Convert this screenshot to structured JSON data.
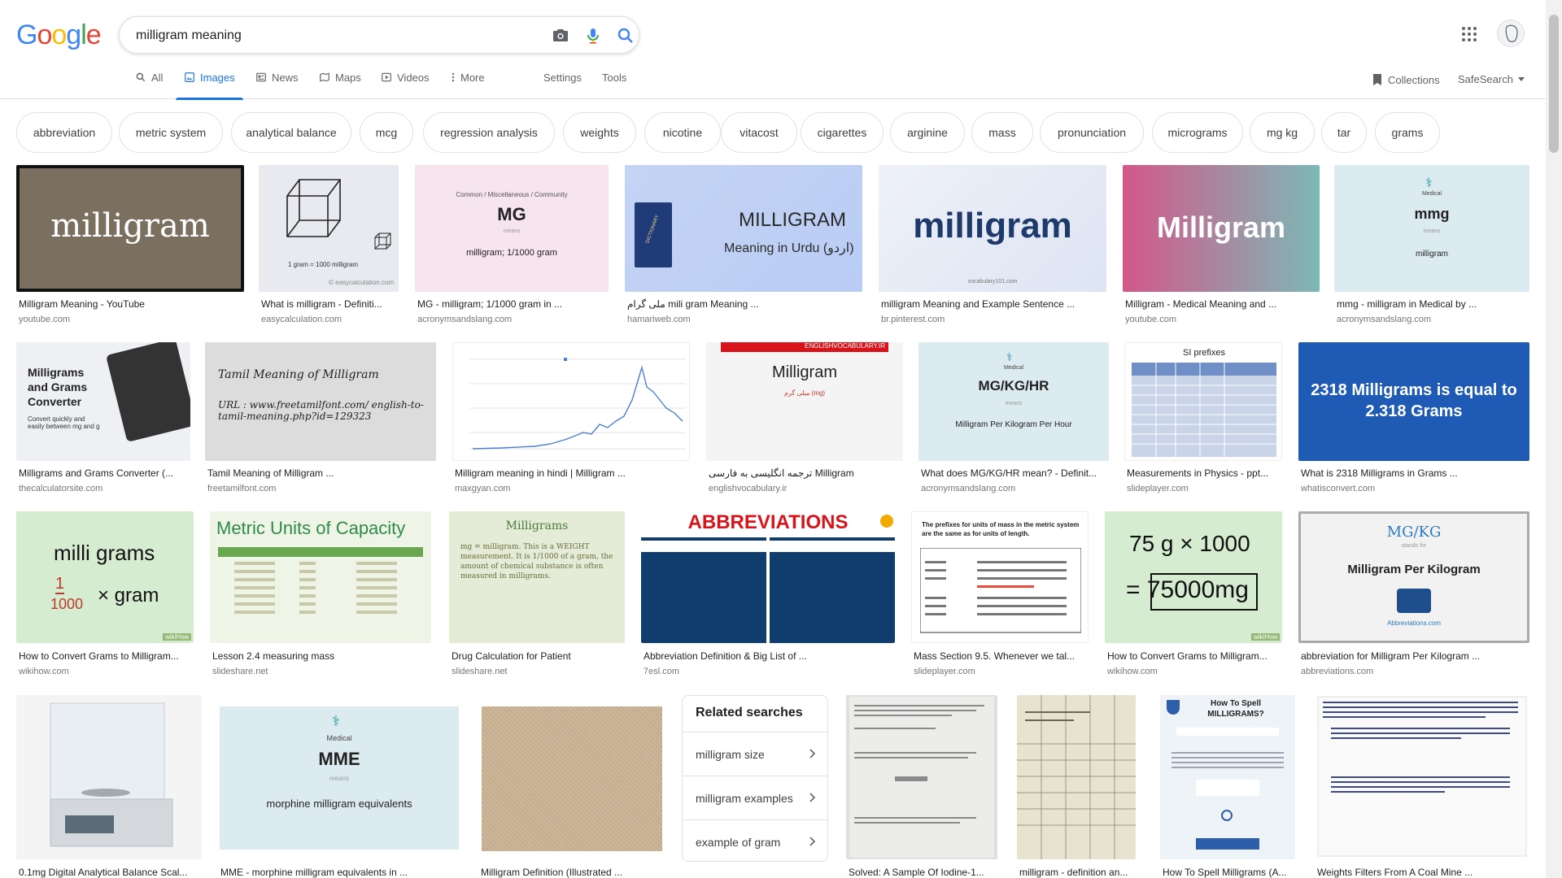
{
  "search": {
    "query": "milligram meaning"
  },
  "tabs": [
    {
      "label": "All",
      "icon": "search-icon"
    },
    {
      "label": "Images",
      "icon": "image-icon",
      "active": true
    },
    {
      "label": "News",
      "icon": "news-icon"
    },
    {
      "label": "Maps",
      "icon": "map-icon"
    },
    {
      "label": "Videos",
      "icon": "video-icon"
    },
    {
      "label": "More",
      "icon": "more-vert-icon"
    }
  ],
  "settings_label": "Settings",
  "tools_label": "Tools",
  "collections_label": "Collections",
  "safesearch_label": "SafeSearch",
  "chips": [
    "abbreviation",
    "metric system",
    "analytical balance",
    "mcg",
    "regression analysis",
    "weights",
    "nicotine",
    "vitacost",
    "cigarettes",
    "arginine",
    "mass",
    "pronunciation",
    "micrograms",
    "mg kg",
    "tar",
    "grams"
  ],
  "results": [
    {
      "caption": "Milligram Meaning - YouTube",
      "source": "youtube.com",
      "thumb_text": "milligram",
      "thumb_sub": ""
    },
    {
      "caption": "What is milligram - Definiti...",
      "source": "easycalculation.com",
      "thumb_text": "1 gram      =      1000 milligram",
      "thumb_sub": "© easycalculation.com"
    },
    {
      "caption": "MG - milligram; 1/1000 gram in ...",
      "source": "acronymsandslang.com",
      "thumb_text": "MG",
      "thumb_sub": "milligram; 1/1000 gram",
      "thumb_top": "Common / Miscellaneous / Community",
      "thumb_means": "means"
    },
    {
      "caption": "ملی گرام mili gram Meaning ...",
      "source": "hamariweb.com",
      "thumb_text": "MILLIGRAM",
      "thumb_sub": "Meaning in Urdu (اردو)",
      "thumb_book": "DICTIONARY"
    },
    {
      "caption": "milligram Meaning and Example Sentence ...",
      "source": "br.pinterest.com",
      "thumb_text": "milligram",
      "thumb_sub": "vocabulary101.com"
    },
    {
      "caption": "Milligram - Medical Meaning and ...",
      "source": "youtube.com",
      "thumb_text": "Milligram",
      "thumb_sub": ""
    },
    {
      "caption": "mmg - milligram in Medical by ...",
      "source": "acronymsandslang.com",
      "thumb_text": "mmg",
      "thumb_sub": "milligram",
      "thumb_top": "Medical",
      "thumb_means": "means"
    },
    {
      "caption": "Milligrams and Grams Converter (...",
      "source": "thecalculatorsite.com",
      "thumb_text": "Milligrams and Grams Converter",
      "thumb_sub": "Convert quickly and easily between mg and g"
    },
    {
      "caption": "Tamil Meaning of Milligram ...",
      "source": "freetamilfont.com",
      "thumb_text": "Tamil Meaning of Milligram",
      "thumb_sub": "URL : www.freetamilfont.com/ english-to-tamil-meaning.php?id=129323"
    },
    {
      "caption": "Milligram meaning in hindi | Milligram ...",
      "source": "maxgyan.com",
      "thumb_text": "",
      "thumb_sub": ""
    },
    {
      "caption": "ترجمه انگلیسی به فارسی Milligram",
      "source": "englishvocabulary.ir",
      "thumb_text": "Milligram",
      "thumb_sub": "میلی گرم (mg)",
      "thumb_top": "ENGLISHVOCABULARY.IR"
    },
    {
      "caption": "What does MG/KG/HR mean? - Definit...",
      "source": "acronymsandslang.com",
      "thumb_text": "MG/KG/HR",
      "thumb_sub": "Milligram Per Kilogram Per Hour",
      "thumb_top": "Medical",
      "thumb_means": "means"
    },
    {
      "caption": "Measurements in Physics - ppt...",
      "source": "slideplayer.com",
      "thumb_text": "SI prefixes",
      "thumb_sub": ""
    },
    {
      "caption": "What is 2318 Milligrams in Grams ...",
      "source": "whatisconvert.com",
      "thumb_text": "2318 Milligrams is equal to 2.318 Grams",
      "thumb_sub": ""
    },
    {
      "caption": "How to Convert Grams to Milligram...",
      "source": "wikihow.com",
      "thumb_text": "milli grams",
      "thumb_sub": "× gram",
      "thumb_frac_n": "1",
      "thumb_frac_d": "1000",
      "thumb_badge": "wikiHow"
    },
    {
      "caption": "Lesson 2.4 measuring mass",
      "source": "slideshare.net",
      "thumb_text": "Metric Units of Capacity",
      "thumb_sub": ""
    },
    {
      "caption": "Drug Calculation for Patient",
      "source": "slideshare.net",
      "thumb_text": "Milligrams",
      "thumb_sub": "mg = milligram. This is a WEIGHT measurement. It is 1/1000 of a gram, the amount of chemical substance is often measured in milligrams."
    },
    {
      "caption": "Abbreviation Definition & Big List of ...",
      "source": "7esl.com",
      "thumb_text": "ABBREVIATIONS",
      "thumb_sub": ""
    },
    {
      "caption": "Mass Section 9.5. Whenever we tal...",
      "source": "slideplayer.com",
      "thumb_text": "The prefixes for units of mass in the metric system are the same as for units of length.",
      "thumb_sub": ""
    },
    {
      "caption": "How to Convert Grams to Milligram...",
      "source": "wikihow.com",
      "thumb_text": "75 g × 1000",
      "thumb_sub": "= 75000mg",
      "thumb_badge": "wikiHow"
    },
    {
      "caption": "abbreviation for Milligram Per Kilogram ...",
      "source": "abbreviations.com",
      "thumb_text": "MG/KG",
      "thumb_sub": "Milligram Per Kilogram",
      "thumb_top": "stands for",
      "thumb_brand": "Abbreviations.com"
    },
    {
      "caption": "0.1mg Digital Analytical Balance Scal...",
      "source": "",
      "thumb_text": "",
      "thumb_sub": ""
    },
    {
      "caption": "MME - morphine milligram equivalents in ...",
      "source": "",
      "thumb_text": "MME",
      "thumb_sub": "morphine milligram equivalents",
      "thumb_top": "Medical",
      "thumb_means": "means"
    },
    {
      "caption": "Milligram Definition (Illustrated ...",
      "source": "",
      "thumb_text": "",
      "thumb_sub": ""
    },
    {
      "caption": "Solved: A Sample Of Iodine-1...",
      "source": "",
      "thumb_text": "",
      "thumb_sub": ""
    },
    {
      "caption": "milligram - definition an...",
      "source": "",
      "thumb_text": "",
      "thumb_sub": ""
    },
    {
      "caption": "How To Spell Milligrams (A...",
      "source": "",
      "thumb_text": "How To Spell MILLIGRAMS?",
      "thumb_sub": ""
    },
    {
      "caption": "Weights Filters From A Coal Mine ...",
      "source": "",
      "thumb_text": "",
      "thumb_sub": ""
    }
  ],
  "related": {
    "title": "Related searches",
    "items": [
      "milligram size",
      "milligram examples",
      "example of gram"
    ]
  }
}
